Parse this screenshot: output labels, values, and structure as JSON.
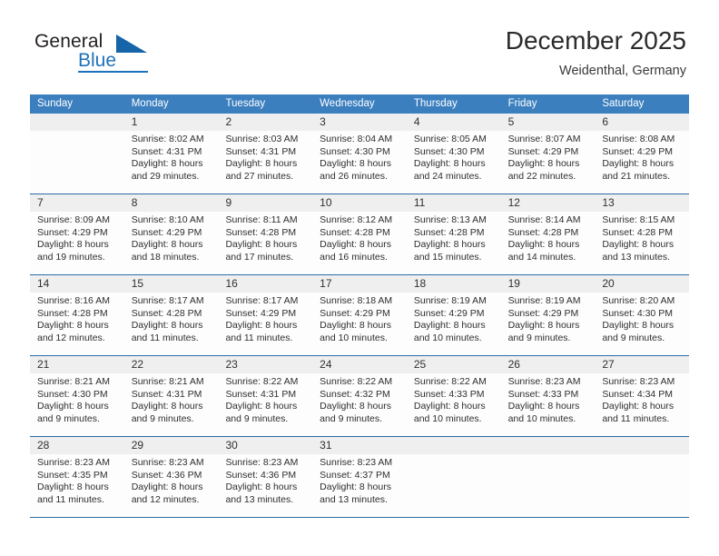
{
  "brand": {
    "name_part1": "General",
    "name_part2": "Blue",
    "logo_icon": "triangle-logo-icon"
  },
  "header": {
    "title": "December 2025",
    "subtitle": "Weidenthal, Germany"
  },
  "colors": {
    "header_blue": "#3c7fbf",
    "separator_blue": "#2a6ca8",
    "daynum_band": "#efefef",
    "brand_blue": "#1e72bb"
  },
  "calendar": {
    "weekday_headers": [
      "Sunday",
      "Monday",
      "Tuesday",
      "Wednesday",
      "Thursday",
      "Friday",
      "Saturday"
    ],
    "weeks": [
      {
        "days": [
          {
            "num": "",
            "lines": []
          },
          {
            "num": "1",
            "lines": [
              "Sunrise: 8:02 AM",
              "Sunset: 4:31 PM",
              "Daylight: 8 hours",
              "and 29 minutes."
            ]
          },
          {
            "num": "2",
            "lines": [
              "Sunrise: 8:03 AM",
              "Sunset: 4:31 PM",
              "Daylight: 8 hours",
              "and 27 minutes."
            ]
          },
          {
            "num": "3",
            "lines": [
              "Sunrise: 8:04 AM",
              "Sunset: 4:30 PM",
              "Daylight: 8 hours",
              "and 26 minutes."
            ]
          },
          {
            "num": "4",
            "lines": [
              "Sunrise: 8:05 AM",
              "Sunset: 4:30 PM",
              "Daylight: 8 hours",
              "and 24 minutes."
            ]
          },
          {
            "num": "5",
            "lines": [
              "Sunrise: 8:07 AM",
              "Sunset: 4:29 PM",
              "Daylight: 8 hours",
              "and 22 minutes."
            ]
          },
          {
            "num": "6",
            "lines": [
              "Sunrise: 8:08 AM",
              "Sunset: 4:29 PM",
              "Daylight: 8 hours",
              "and 21 minutes."
            ]
          }
        ]
      },
      {
        "days": [
          {
            "num": "7",
            "lines": [
              "Sunrise: 8:09 AM",
              "Sunset: 4:29 PM",
              "Daylight: 8 hours",
              "and 19 minutes."
            ]
          },
          {
            "num": "8",
            "lines": [
              "Sunrise: 8:10 AM",
              "Sunset: 4:29 PM",
              "Daylight: 8 hours",
              "and 18 minutes."
            ]
          },
          {
            "num": "9",
            "lines": [
              "Sunrise: 8:11 AM",
              "Sunset: 4:28 PM",
              "Daylight: 8 hours",
              "and 17 minutes."
            ]
          },
          {
            "num": "10",
            "lines": [
              "Sunrise: 8:12 AM",
              "Sunset: 4:28 PM",
              "Daylight: 8 hours",
              "and 16 minutes."
            ]
          },
          {
            "num": "11",
            "lines": [
              "Sunrise: 8:13 AM",
              "Sunset: 4:28 PM",
              "Daylight: 8 hours",
              "and 15 minutes."
            ]
          },
          {
            "num": "12",
            "lines": [
              "Sunrise: 8:14 AM",
              "Sunset: 4:28 PM",
              "Daylight: 8 hours",
              "and 14 minutes."
            ]
          },
          {
            "num": "13",
            "lines": [
              "Sunrise: 8:15 AM",
              "Sunset: 4:28 PM",
              "Daylight: 8 hours",
              "and 13 minutes."
            ]
          }
        ]
      },
      {
        "days": [
          {
            "num": "14",
            "lines": [
              "Sunrise: 8:16 AM",
              "Sunset: 4:28 PM",
              "Daylight: 8 hours",
              "and 12 minutes."
            ]
          },
          {
            "num": "15",
            "lines": [
              "Sunrise: 8:17 AM",
              "Sunset: 4:28 PM",
              "Daylight: 8 hours",
              "and 11 minutes."
            ]
          },
          {
            "num": "16",
            "lines": [
              "Sunrise: 8:17 AM",
              "Sunset: 4:29 PM",
              "Daylight: 8 hours",
              "and 11 minutes."
            ]
          },
          {
            "num": "17",
            "lines": [
              "Sunrise: 8:18 AM",
              "Sunset: 4:29 PM",
              "Daylight: 8 hours",
              "and 10 minutes."
            ]
          },
          {
            "num": "18",
            "lines": [
              "Sunrise: 8:19 AM",
              "Sunset: 4:29 PM",
              "Daylight: 8 hours",
              "and 10 minutes."
            ]
          },
          {
            "num": "19",
            "lines": [
              "Sunrise: 8:19 AM",
              "Sunset: 4:29 PM",
              "Daylight: 8 hours",
              "and 9 minutes."
            ]
          },
          {
            "num": "20",
            "lines": [
              "Sunrise: 8:20 AM",
              "Sunset: 4:30 PM",
              "Daylight: 8 hours",
              "and 9 minutes."
            ]
          }
        ]
      },
      {
        "days": [
          {
            "num": "21",
            "lines": [
              "Sunrise: 8:21 AM",
              "Sunset: 4:30 PM",
              "Daylight: 8 hours",
              "and 9 minutes."
            ]
          },
          {
            "num": "22",
            "lines": [
              "Sunrise: 8:21 AM",
              "Sunset: 4:31 PM",
              "Daylight: 8 hours",
              "and 9 minutes."
            ]
          },
          {
            "num": "23",
            "lines": [
              "Sunrise: 8:22 AM",
              "Sunset: 4:31 PM",
              "Daylight: 8 hours",
              "and 9 minutes."
            ]
          },
          {
            "num": "24",
            "lines": [
              "Sunrise: 8:22 AM",
              "Sunset: 4:32 PM",
              "Daylight: 8 hours",
              "and 9 minutes."
            ]
          },
          {
            "num": "25",
            "lines": [
              "Sunrise: 8:22 AM",
              "Sunset: 4:33 PM",
              "Daylight: 8 hours",
              "and 10 minutes."
            ]
          },
          {
            "num": "26",
            "lines": [
              "Sunrise: 8:23 AM",
              "Sunset: 4:33 PM",
              "Daylight: 8 hours",
              "and 10 minutes."
            ]
          },
          {
            "num": "27",
            "lines": [
              "Sunrise: 8:23 AM",
              "Sunset: 4:34 PM",
              "Daylight: 8 hours",
              "and 11 minutes."
            ]
          }
        ]
      },
      {
        "days": [
          {
            "num": "28",
            "lines": [
              "Sunrise: 8:23 AM",
              "Sunset: 4:35 PM",
              "Daylight: 8 hours",
              "and 11 minutes."
            ]
          },
          {
            "num": "29",
            "lines": [
              "Sunrise: 8:23 AM",
              "Sunset: 4:36 PM",
              "Daylight: 8 hours",
              "and 12 minutes."
            ]
          },
          {
            "num": "30",
            "lines": [
              "Sunrise: 8:23 AM",
              "Sunset: 4:36 PM",
              "Daylight: 8 hours",
              "and 13 minutes."
            ]
          },
          {
            "num": "31",
            "lines": [
              "Sunrise: 8:23 AM",
              "Sunset: 4:37 PM",
              "Daylight: 8 hours",
              "and 13 minutes."
            ]
          },
          {
            "num": "",
            "lines": []
          },
          {
            "num": "",
            "lines": []
          },
          {
            "num": "",
            "lines": []
          }
        ]
      }
    ]
  }
}
